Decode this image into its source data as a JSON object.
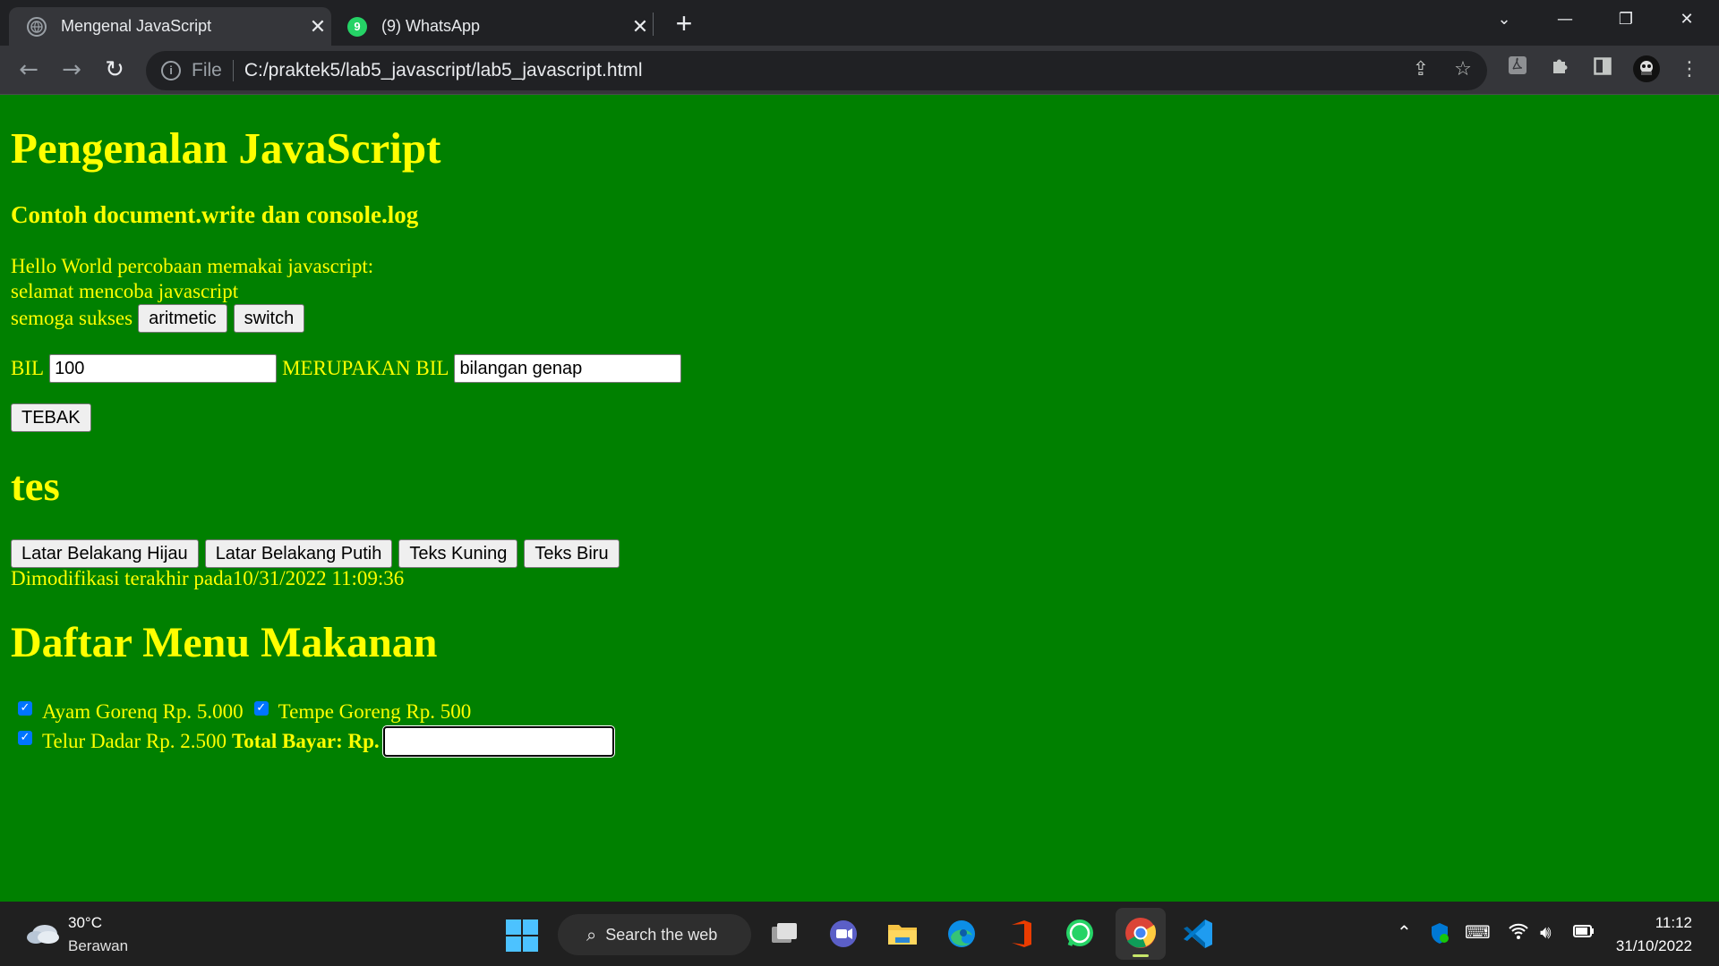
{
  "browser": {
    "tabs": [
      {
        "title": "Mengenal JavaScript",
        "active": true
      },
      {
        "title": "(9) WhatsApp",
        "active": false,
        "badge": "9"
      }
    ],
    "new_tab": "+",
    "address": {
      "scheme": "File",
      "url": "C:/praktek5/lab5_javascript/lab5_javascript.html"
    }
  },
  "page": {
    "title": "Pengenalan JavaScript",
    "subtitle": "Contoh document.write dan console.log",
    "lines": [
      "Hello World percobaan memakai javascript:",
      "selamat mencoba javascript",
      "semoga sukses"
    ],
    "buttons": {
      "aritmetic": "aritmetic",
      "switch": "switch"
    },
    "bil_label": "BIL",
    "bil_value": "100",
    "merupakan_label": "MERUPAKAN BIL",
    "result_value": "bilangan genap",
    "tebak": "TEBAK",
    "tes_heading": "tes",
    "color_buttons": [
      "Latar Belakang Hijau",
      "Latar Belakang Putih",
      "Teks Kuning",
      "Teks Biru"
    ],
    "modified": "Dimodifikasi terakhir pada10/31/2022 11:09:36",
    "menu_heading": "Daftar Menu Makanan",
    "menu_items": [
      {
        "label": "Ayam Gorenq Rp. 5.000",
        "checked": true
      },
      {
        "label": "Tempe Goreng Rp. 500",
        "checked": true
      },
      {
        "label": "Telur Dadar Rp. 2.500",
        "checked": true
      }
    ],
    "total_label": "Total Bayar: Rp.",
    "total_value": ""
  },
  "taskbar": {
    "weather": {
      "temp": "30°C",
      "desc": "Berawan"
    },
    "search": "Search the web",
    "clock": {
      "time": "11:12",
      "date": "31/10/2022"
    }
  },
  "colors": {
    "page_bg": "#008000",
    "page_text": "#ffff00"
  }
}
